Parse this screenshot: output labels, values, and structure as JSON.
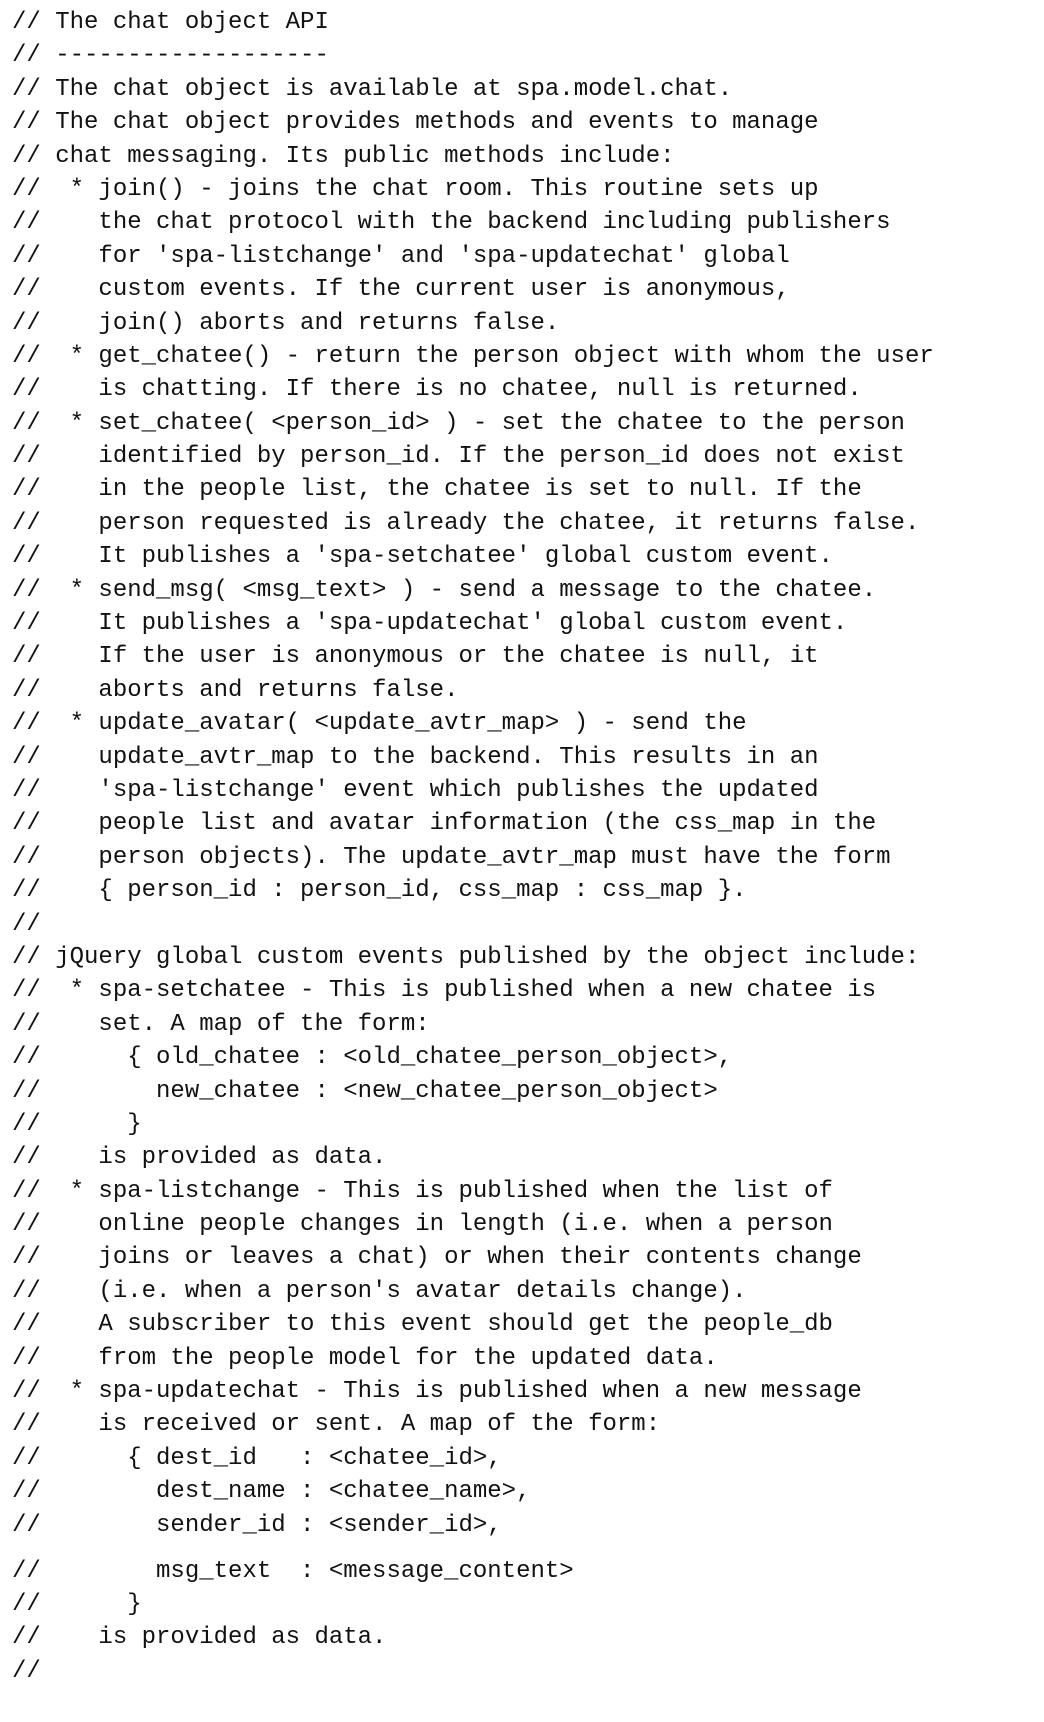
{
  "document": {
    "lines": [
      "// The chat object API",
      "// -------------------",
      "// The chat object is available at spa.model.chat.",
      "// The chat object provides methods and events to manage",
      "// chat messaging. Its public methods include:",
      "//  * join() - joins the chat room. This routine sets up",
      "//    the chat protocol with the backend including publishers",
      "//    for 'spa-listchange' and 'spa-updatechat' global",
      "//    custom events. If the current user is anonymous,",
      "//    join() aborts and returns false.",
      "//  * get_chatee() - return the person object with whom the user",
      "//    is chatting. If there is no chatee, null is returned.",
      "//  * set_chatee( <person_id> ) - set the chatee to the person",
      "//    identified by person_id. If the person_id does not exist",
      "//    in the people list, the chatee is set to null. If the",
      "//    person requested is already the chatee, it returns false.",
      "//    It publishes a 'spa-setchatee' global custom event.",
      "//  * send_msg( <msg_text> ) - send a message to the chatee.",
      "//    It publishes a 'spa-updatechat' global custom event.",
      "//    If the user is anonymous or the chatee is null, it",
      "//    aborts and returns false.",
      "//  * update_avatar( <update_avtr_map> ) - send the",
      "//    update_avtr_map to the backend. This results in an",
      "//    'spa-listchange' event which publishes the updated",
      "//    people list and avatar information (the css_map in the",
      "//    person objects). The update_avtr_map must have the form",
      "//    { person_id : person_id, css_map : css_map }.",
      "//",
      "// jQuery global custom events published by the object include:",
      "//  * spa-setchatee - This is published when a new chatee is",
      "//    set. A map of the form:",
      "//      { old_chatee : <old_chatee_person_object>,",
      "//        new_chatee : <new_chatee_person_object>",
      "//      }",
      "//    is provided as data.",
      "//  * spa-listchange - This is published when the list of",
      "//    online people changes in length (i.e. when a person",
      "//    joins or leaves a chat) or when their contents change",
      "//    (i.e. when a person's avatar details change).",
      "//    A subscriber to this event should get the people_db",
      "//    from the people model for the updated data.",
      "//  * spa-updatechat - This is published when a new message",
      "//    is received or sent. A map of the form:",
      "//      { dest_id   : <chatee_id>,",
      "//        dest_name : <chatee_name>,",
      "//        sender_id : <sender_id>,",
      "//        msg_text  : <message_content>",
      "//      }",
      "//    is provided as data.",
      "//"
    ]
  }
}
